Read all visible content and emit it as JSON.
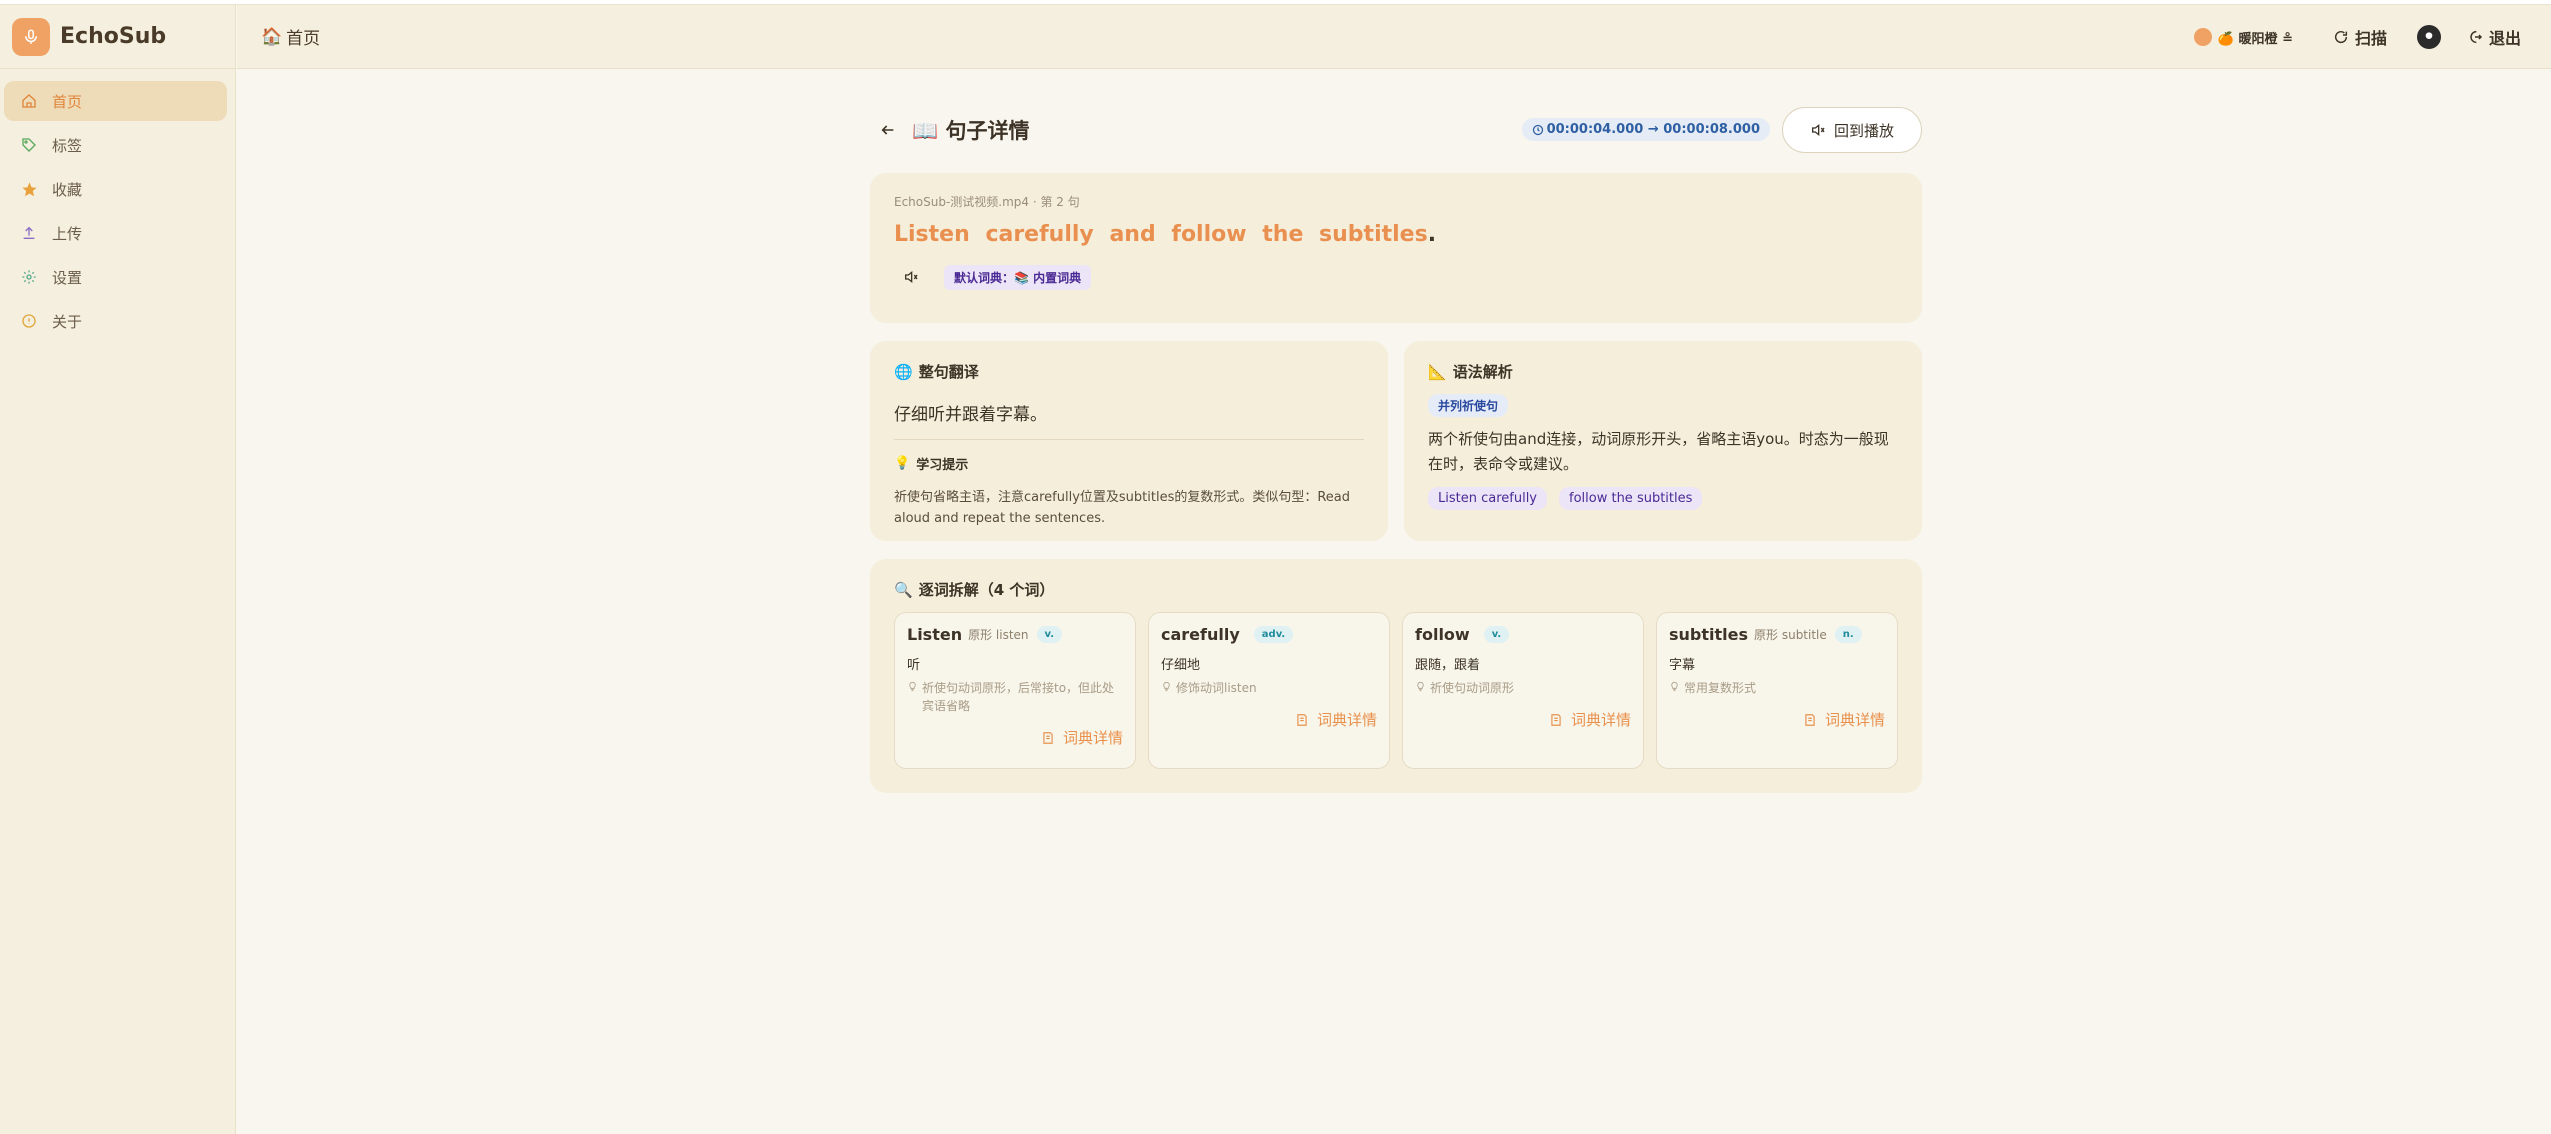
{
  "app": {
    "name": "EchoSub"
  },
  "sidebar": {
    "items": [
      {
        "label": "首页",
        "icon": "home-icon",
        "active": true
      },
      {
        "label": "标签",
        "icon": "tag-icon"
      },
      {
        "label": "收藏",
        "icon": "star-icon"
      },
      {
        "label": "上传",
        "icon": "upload-icon"
      },
      {
        "label": "设置",
        "icon": "settings-icon"
      },
      {
        "label": "关于",
        "icon": "info-icon"
      }
    ]
  },
  "topbar": {
    "breadcrumb": "首页",
    "username": "🍊 暖阳橙 ≗",
    "scan_label": "扫描",
    "logout_label": "退出"
  },
  "page": {
    "title": "📖 句子详情",
    "time_range": "00:00:04.000 → 00:00:08.000",
    "replay_label": "回到播放"
  },
  "sentence": {
    "source": "EchoSub-测试视频.mp4 · 第 2 句",
    "words": [
      "Listen",
      "carefully",
      "and",
      "follow",
      "the",
      "subtitles"
    ],
    "punct": ".",
    "dict_tag": "默认词典：📚 内置词典"
  },
  "translation": {
    "title": "整句翻译",
    "text": "仔细听并跟着字幕。",
    "tip_title": "学习提示",
    "tip_text": "祈使句省略主语，注意carefully位置及subtitles的复数形式。类似句型：Read aloud and repeat the sentences."
  },
  "grammar": {
    "title": "语法解析",
    "tag": "并列祈使句",
    "text": "两个祈使句由and连接，动词原形开头，省略主语you。时态为一般现在时，表命令或建议。",
    "chips": [
      "Listen carefully",
      "follow the subtitles"
    ]
  },
  "breakdown": {
    "title": "逐词拆解（4 个词）",
    "link_label": "词典详情",
    "words": [
      {
        "word": "Listen",
        "lemma": "原形 listen",
        "pos": "v.",
        "meaning": "听",
        "note": "祈使句动词原形，后常接to，但此处宾语省略"
      },
      {
        "word": "carefully",
        "lemma": "",
        "pos": "adv.",
        "meaning": "仔细地",
        "note": "修饰动词listen"
      },
      {
        "word": "follow",
        "lemma": "",
        "pos": "v.",
        "meaning": "跟随，跟着",
        "note": "祈使句动词原形"
      },
      {
        "word": "subtitles",
        "lemma": "原形 subtitle",
        "pos": "n.",
        "meaning": "字幕",
        "note": "常用复数形式"
      }
    ]
  },
  "colors": {
    "accent": "#e99050",
    "sidebar_bg": "#f5efdf",
    "card_bg": "#f5eedb",
    "page_bg": "#f8f6ee"
  }
}
